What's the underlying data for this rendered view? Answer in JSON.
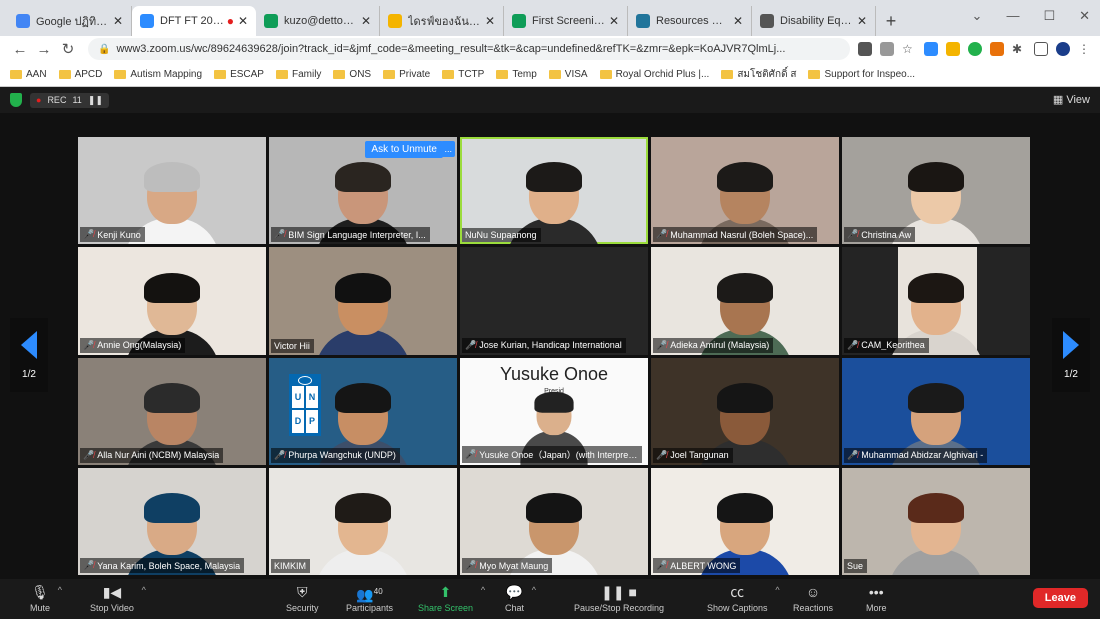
{
  "browser": {
    "tabs": [
      {
        "label": "Google ปฏิทิน - ",
        "color": "#4285f4"
      },
      {
        "label": "DFT FT 2021",
        "color": "#2d8cff",
        "recording": true
      },
      {
        "label": "kuzo@dettonun",
        "color": "#0f9d58"
      },
      {
        "label": "ไดรฟ์ของฉัน - Goo",
        "color": "#f4b400"
      },
      {
        "label": "First Screening",
        "color": "#0f9d58"
      },
      {
        "label": "Resources & Lin",
        "color": "#21759b"
      },
      {
        "label": "Disability Equal",
        "color": "#555555"
      }
    ],
    "new_tab": "+",
    "address": "www3.zoom.us/wc/89624639628/join?track_id=&jmf_code=&meeting_result=&tk=&cap=undefined&refTK=&zmr=&epk=KoAJVR7QlmLj...",
    "bookmarks": [
      "AAN",
      "APCD",
      "Autism Mapping",
      "ESCAP",
      "Family",
      "ONS",
      "Private",
      "TCTP",
      "Temp",
      "VISA",
      "Royal Orchid Plus |...",
      "สมโชติศักดิ์ ส",
      "Support for Inspeo..."
    ]
  },
  "zoom": {
    "rec_text": "REC",
    "rec_time": "11",
    "view_label": "View",
    "page_indicator": "1/2",
    "ask_to_unmute": "Ask to Unmute",
    "more_dots": "...",
    "slide_title": "Yusuke Onoe",
    "slide_sub": "Presid",
    "participants": [
      {
        "name": "Kenji Kuno",
        "muted": true,
        "bg": "#c9c9c9",
        "skin": "#d8a885",
        "hair": "#bdbdbd",
        "shirt": "#f4f4f4"
      },
      {
        "name": "BIM Sign Language Interpreter, I...",
        "muted": true,
        "bg": "#b7b7b7",
        "skin": "#c9967a",
        "hair": "#2a2520",
        "shirt": "#1e1e1e"
      },
      {
        "name": "NuNu Supaanong",
        "muted": false,
        "bg": "#d8dbdc",
        "skin": "#e0b08a",
        "hair": "#1c1a18",
        "shirt": "#2a2a2a",
        "speaking": true
      },
      {
        "name": "Muhammad Nasrul (Boleh Space)...",
        "muted": true,
        "bg": "#b9a59a",
        "skin": "#b58460",
        "hair": "#1c1a18",
        "shirt": "#7a6a5f"
      },
      {
        "name": "Christina Aw",
        "muted": true,
        "bg": "#a4a19c",
        "skin": "#ecc9a8",
        "hair": "#1a1613",
        "shirt": "#e8e4df"
      },
      {
        "name": "Annie Ong(Malaysia)",
        "muted": true,
        "bg": "#ece6df",
        "skin": "#e0b896",
        "hair": "#141210",
        "shirt": "#1c1c1c"
      },
      {
        "name": "Victor Hii",
        "muted": false,
        "bg": "#9d8f80",
        "skin": "#c98f62",
        "hair": "#111111",
        "shirt": "#2a3d6a"
      },
      {
        "name": "Jose Kurian, Handicap International",
        "muted": true,
        "bg": "#262626",
        "empty": true
      },
      {
        "name": "Adieka Amirul (Malaysia)",
        "muted": true,
        "bg": "#e9e5df",
        "skin": "#a87550",
        "hair": "#1c1a18",
        "shirt": "#4d6b55"
      },
      {
        "name": "CAM_Keorithea",
        "muted": true,
        "bg": "#242424",
        "skin": "#e2b28c",
        "hair": "#1c1713",
        "shirt": "#d9d4ce",
        "narrow": true
      },
      {
        "name": "Alla Nur Aini (NCBM) Malaysia",
        "muted": true,
        "bg": "#8a8178",
        "skin": "#b98564",
        "hair": "#2b2b2b",
        "shirt": "#3a3a3a"
      },
      {
        "name": "Phurpa Wangchuk (UNDP)",
        "muted": true,
        "bg": "#265d86",
        "skin": "#c78e64",
        "hair": "#151515",
        "shirt": "#3d4f6a",
        "logo": true
      },
      {
        "name": "Yusuke Onoe（Japan）(with Interpreter)",
        "muted": true,
        "bg": "#fafafa",
        "skin": "#dbb08c",
        "hair": "#222222",
        "shirt": "#4a4a4a",
        "slide": true
      },
      {
        "name": "Joel Tangunan",
        "muted": true,
        "bg": "#3e3328",
        "skin": "#8a5a3a",
        "hair": "#151515",
        "shirt": "#2e2e2e"
      },
      {
        "name": "Muhammad Abidzar Alghivari -",
        "muted": true,
        "bg": "#1b4f9c",
        "skin": "#d5a27c",
        "hair": "#1a1a1a",
        "shirt": "#5b6f8a"
      },
      {
        "name": "Yana Karim, Boleh Space, Malaysia",
        "muted": true,
        "bg": "#d6d3cf",
        "skin": "#d9aa86",
        "hair": "#0f3f63",
        "shirt": "#0f3f63"
      },
      {
        "name": "KIMKIM",
        "muted": false,
        "bg": "#e8e6e2",
        "skin": "#e3b690",
        "hair": "#1f1b17",
        "shirt": "#eeeeee"
      },
      {
        "name": "Myo Myat Maung",
        "muted": true,
        "bg": "#dedad4",
        "skin": "#c9966c",
        "hair": "#141414",
        "shirt": "#f2f2f2"
      },
      {
        "name": "ALBERT WONG",
        "muted": true,
        "bg": "#f0ece6",
        "skin": "#d8a67e",
        "hair": "#151515",
        "shirt": "#1c4aa8"
      },
      {
        "name": "Sue",
        "muted": false,
        "bg": "#bdb6ad",
        "skin": "#e3b591",
        "hair": "#5a2a1a",
        "shirt": "#a0a0a0"
      }
    ],
    "toolbar": {
      "mute": "Mute",
      "stop_video": "Stop Video",
      "security": "Security",
      "participants": "Participants",
      "participants_count": "40",
      "share_screen": "Share Screen",
      "chat": "Chat",
      "record": "Pause/Stop Recording",
      "captions": "Show Captions",
      "reactions": "Reactions",
      "more": "More",
      "leave": "Leave"
    }
  }
}
